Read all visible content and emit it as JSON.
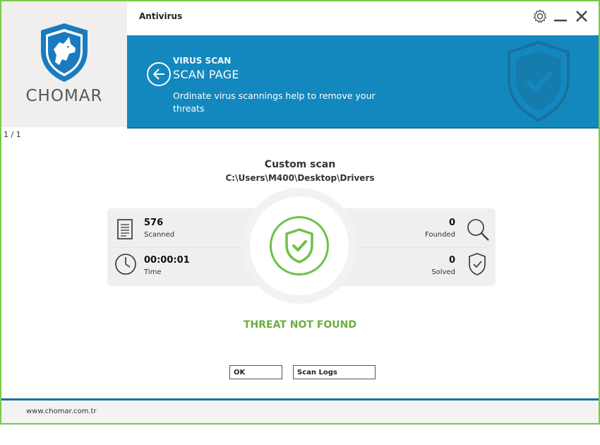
{
  "app": {
    "title": "Antivirus",
    "logo_text": "CHOMAR"
  },
  "header": {
    "breadcrumb": "VIRUS SCAN",
    "page_title": "SCAN PAGE",
    "description": "Ordinate virus scannings help to remove your threats"
  },
  "pager": "1 / 1",
  "scan": {
    "title": "Custom scan",
    "path": "C:\\Users\\M400\\Desktop\\Drivers"
  },
  "stats": {
    "scanned": {
      "value": "576",
      "label": "Scanned"
    },
    "time": {
      "value": "00:00:01",
      "label": "Time"
    },
    "founded": {
      "value": "0",
      "label": "Founded"
    },
    "solved": {
      "value": "0",
      "label": "Solved"
    }
  },
  "result": "THREAT NOT FOUND",
  "buttons": {
    "ok": "OK",
    "scan_logs": "Scan Logs"
  },
  "footer": {
    "website": "www.chomar.com.tr"
  },
  "colors": {
    "accent": "#1388be",
    "success": "#6aaf3d",
    "window_border": "#7dc84b",
    "logo_blue": "#1a7bbf"
  },
  "icons": {
    "logo": "dog-shield-icon",
    "settings": "gear-icon",
    "minimize": "minimize-icon",
    "close": "close-icon",
    "back": "back-arrow-icon",
    "scanned": "document-icon",
    "time": "clock-icon",
    "founded": "magnifier-icon",
    "solved": "shield-check-icon",
    "status": "shield-check-icon"
  }
}
